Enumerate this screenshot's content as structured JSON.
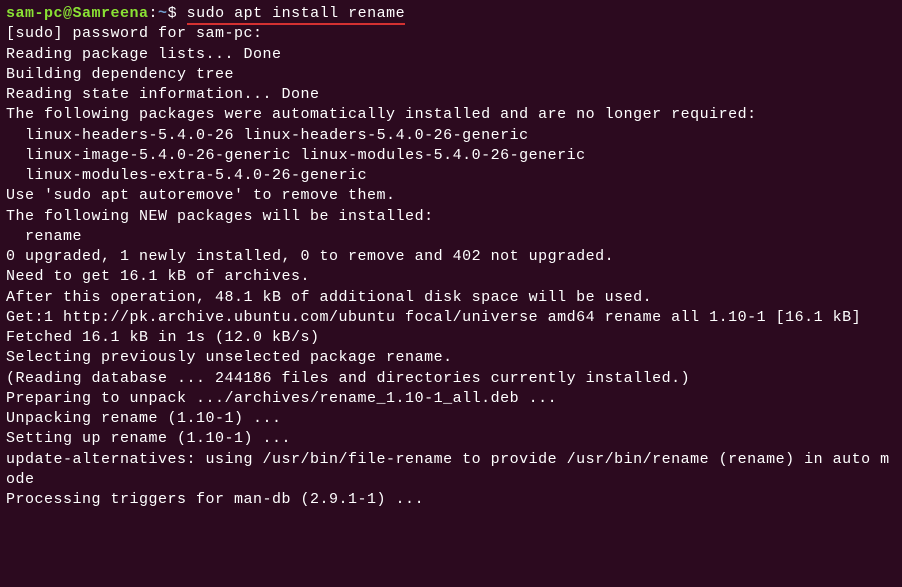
{
  "prompt": {
    "user_host": "sam-pc@Samreena",
    "colon": ":",
    "path": "~",
    "dollar": "$ ",
    "command": "sudo apt install rename"
  },
  "output_lines": [
    "[sudo] password for sam-pc:",
    "Reading package lists... Done",
    "Building dependency tree",
    "Reading state information... Done",
    "The following packages were automatically installed and are no longer required:",
    "  linux-headers-5.4.0-26 linux-headers-5.4.0-26-generic",
    "  linux-image-5.4.0-26-generic linux-modules-5.4.0-26-generic",
    "  linux-modules-extra-5.4.0-26-generic",
    "Use 'sudo apt autoremove' to remove them.",
    "The following NEW packages will be installed:",
    "  rename",
    "0 upgraded, 1 newly installed, 0 to remove and 402 not upgraded.",
    "Need to get 16.1 kB of archives.",
    "After this operation, 48.1 kB of additional disk space will be used.",
    "Get:1 http://pk.archive.ubuntu.com/ubuntu focal/universe amd64 rename all 1.10-1 [16.1 kB]",
    "Fetched 16.1 kB in 1s (12.0 kB/s)",
    "Selecting previously unselected package rename.",
    "(Reading database ... 244186 files and directories currently installed.)",
    "Preparing to unpack .../archives/rename_1.10-1_all.deb ...",
    "Unpacking rename (1.10-1) ...",
    "Setting up rename (1.10-1) ...",
    "update-alternatives: using /usr/bin/file-rename to provide /usr/bin/rename (rename) in auto mode",
    "Processing triggers for man-db (2.9.1-1) ..."
  ]
}
